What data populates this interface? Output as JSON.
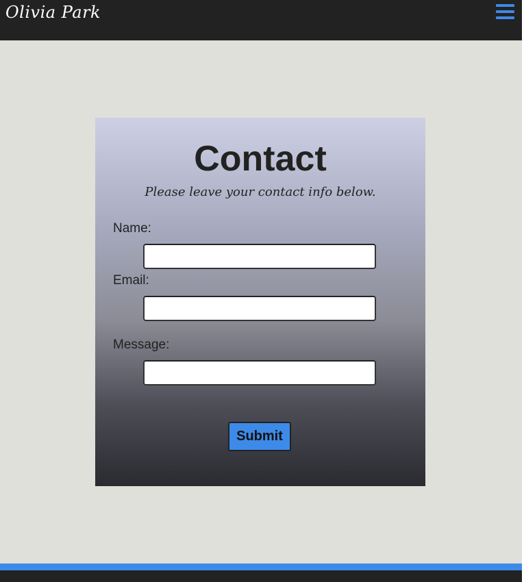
{
  "header": {
    "brand": "Olivia Park",
    "menu_icon": "hamburger-menu-icon"
  },
  "contact": {
    "title": "Contact",
    "subtitle": "Please leave your contact info below.",
    "fields": [
      {
        "label": "Name:",
        "value": ""
      },
      {
        "label": "Email:",
        "value": ""
      },
      {
        "label": "Message:",
        "value": ""
      }
    ],
    "submit_label": "Submit"
  },
  "colors": {
    "header_bg": "#222222",
    "page_bg": "#dfe0da",
    "accent": "#3d8ae8",
    "card_gradient_top": "#cdd0e4",
    "card_gradient_bottom": "#2a2a30"
  }
}
